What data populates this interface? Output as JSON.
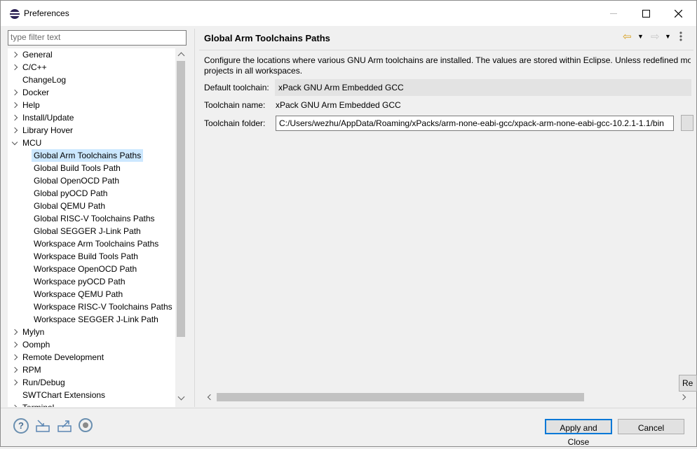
{
  "window": {
    "title": "Preferences"
  },
  "filter": {
    "placeholder": "type filter text"
  },
  "tree": {
    "items": [
      {
        "label": "General",
        "expander": "collapsed"
      },
      {
        "label": "C/C++",
        "expander": "collapsed"
      },
      {
        "label": "ChangeLog",
        "expander": "none"
      },
      {
        "label": "Docker",
        "expander": "collapsed"
      },
      {
        "label": "Help",
        "expander": "collapsed"
      },
      {
        "label": "Install/Update",
        "expander": "collapsed"
      },
      {
        "label": "Library Hover",
        "expander": "collapsed"
      },
      {
        "label": "MCU",
        "expander": "expanded"
      },
      {
        "label": "Global Arm Toolchains Paths",
        "child": true,
        "selected": true
      },
      {
        "label": "Global Build Tools Path",
        "child": true
      },
      {
        "label": "Global OpenOCD Path",
        "child": true
      },
      {
        "label": "Global pyOCD Path",
        "child": true
      },
      {
        "label": "Global QEMU Path",
        "child": true
      },
      {
        "label": "Global RISC-V Toolchains Paths",
        "child": true
      },
      {
        "label": "Global SEGGER J-Link Path",
        "child": true
      },
      {
        "label": "Workspace Arm Toolchains Paths",
        "child": true
      },
      {
        "label": "Workspace Build Tools Path",
        "child": true
      },
      {
        "label": "Workspace OpenOCD Path",
        "child": true
      },
      {
        "label": "Workspace pyOCD Path",
        "child": true
      },
      {
        "label": "Workspace QEMU Path",
        "child": true
      },
      {
        "label": "Workspace RISC-V Toolchains Paths",
        "child": true
      },
      {
        "label": "Workspace SEGGER J-Link Path",
        "child": true
      },
      {
        "label": "Mylyn",
        "expander": "collapsed"
      },
      {
        "label": "Oomph",
        "expander": "collapsed"
      },
      {
        "label": "Remote Development",
        "expander": "collapsed"
      },
      {
        "label": "RPM",
        "expander": "collapsed"
      },
      {
        "label": "Run/Debug",
        "expander": "collapsed"
      },
      {
        "label": "SWTChart Extensions",
        "expander": "none"
      },
      {
        "label": "Terminal",
        "expander": "collapsed"
      }
    ]
  },
  "page": {
    "title": "Global Arm Toolchains Paths",
    "description_line1": "Configure the locations where various GNU Arm toolchains are installed. The values are stored within Eclipse. Unless redefined more",
    "description_line2": "projects in all workspaces.",
    "default_toolchain_label": "Default toolchain:",
    "default_toolchain_value": "xPack GNU Arm Embedded GCC",
    "toolchain_name_label": "Toolchain name:",
    "toolchain_name_value": "xPack GNU Arm Embedded GCC",
    "toolchain_folder_label": "Toolchain folder:",
    "toolchain_folder_value": "C:/Users/wezhu/AppData/Roaming/xPacks/arm-none-eabi-gcc/xpack-arm-none-eabi-gcc-10.2.1-1.1/bin",
    "restore_button_label": "Re"
  },
  "buttons": {
    "apply_close": "Apply and Close",
    "cancel": "Cancel"
  },
  "icons": {
    "help": "?"
  },
  "colors": {
    "selection": "#cce8ff",
    "default_button_border": "#0078d7",
    "back_arrow": "#d7a020"
  }
}
